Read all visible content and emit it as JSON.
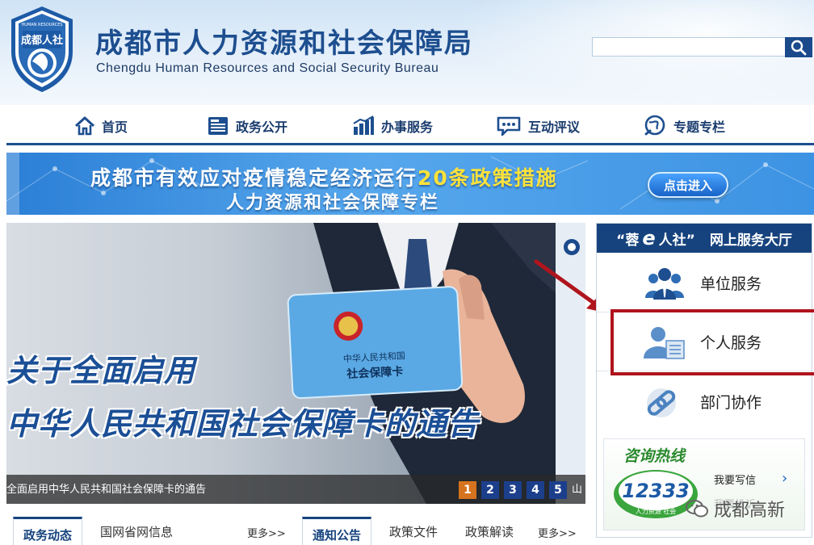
{
  "header": {
    "logo_text": "成都人社",
    "logo_ring_text": "HUMAN RESOURCES",
    "title_cn": "成都市人力资源和社会保障局",
    "title_en": "Chengdu Human Resources and Social Security Bureau",
    "search": {
      "value": "",
      "placeholder": "",
      "icon": "search-icon"
    }
  },
  "nav": {
    "items": [
      {
        "label": "首页",
        "icon": "home-icon"
      },
      {
        "label": "政务公开",
        "icon": "news-icon"
      },
      {
        "label": "办事服务",
        "icon": "bar-chart-icon"
      },
      {
        "label": "互动评议",
        "icon": "chat-icon"
      },
      {
        "label": "专题专栏",
        "icon": "globe-icon"
      }
    ]
  },
  "banner": {
    "line1_part1": "成都市有效应对疫情稳定经济运行",
    "line1_highlight": "20条政策措施",
    "line2": "人力资源和社会保障专栏",
    "button": "点击进入"
  },
  "slider": {
    "headline1": "关于全面启用",
    "headline2": "中华人民共和国社会保障卡的通告",
    "card_line1": "中华人民共和国",
    "card_line2": "社会保障卡",
    "caption": "全面启用中华人民共和国社会保障卡的通告",
    "pages": [
      "1",
      "2",
      "3",
      "4",
      "5"
    ],
    "active_page": "1",
    "overflow_glyph": "山"
  },
  "panel": {
    "title_prefix": "“蓉",
    "title_e": "e",
    "title_suffix": "人社”",
    "title_rest": "网上服务大厅",
    "services": [
      {
        "label": "单位服务",
        "icon": "group-users-icon"
      },
      {
        "label": "个人服务",
        "icon": "person-document-icon"
      },
      {
        "label": "部门协作",
        "icon": "link-icon"
      }
    ],
    "hotline": {
      "title": "咨询热线",
      "number": "12333",
      "badge_sub": "人力资源 社会",
      "write_label": "我要写信",
      "second_label": "我要投诉"
    }
  },
  "watermark": {
    "text": "成都高新",
    "icon": "wechat-icon"
  },
  "tabs": {
    "left": [
      {
        "label": "政务动态"
      },
      {
        "label": "国网省网信息"
      }
    ],
    "left_more": "更多>>",
    "right": [
      {
        "label": "通知公告"
      },
      {
        "label": "政策文件"
      },
      {
        "label": "政策解读"
      }
    ],
    "right_more": "更多>>"
  },
  "colors": {
    "brand_blue": "#1d4e8f",
    "panel_head": "#16437e",
    "highlight_yellow": "#ffe23a",
    "annotation_red": "#b0141c",
    "active_page": "#d6731e"
  }
}
